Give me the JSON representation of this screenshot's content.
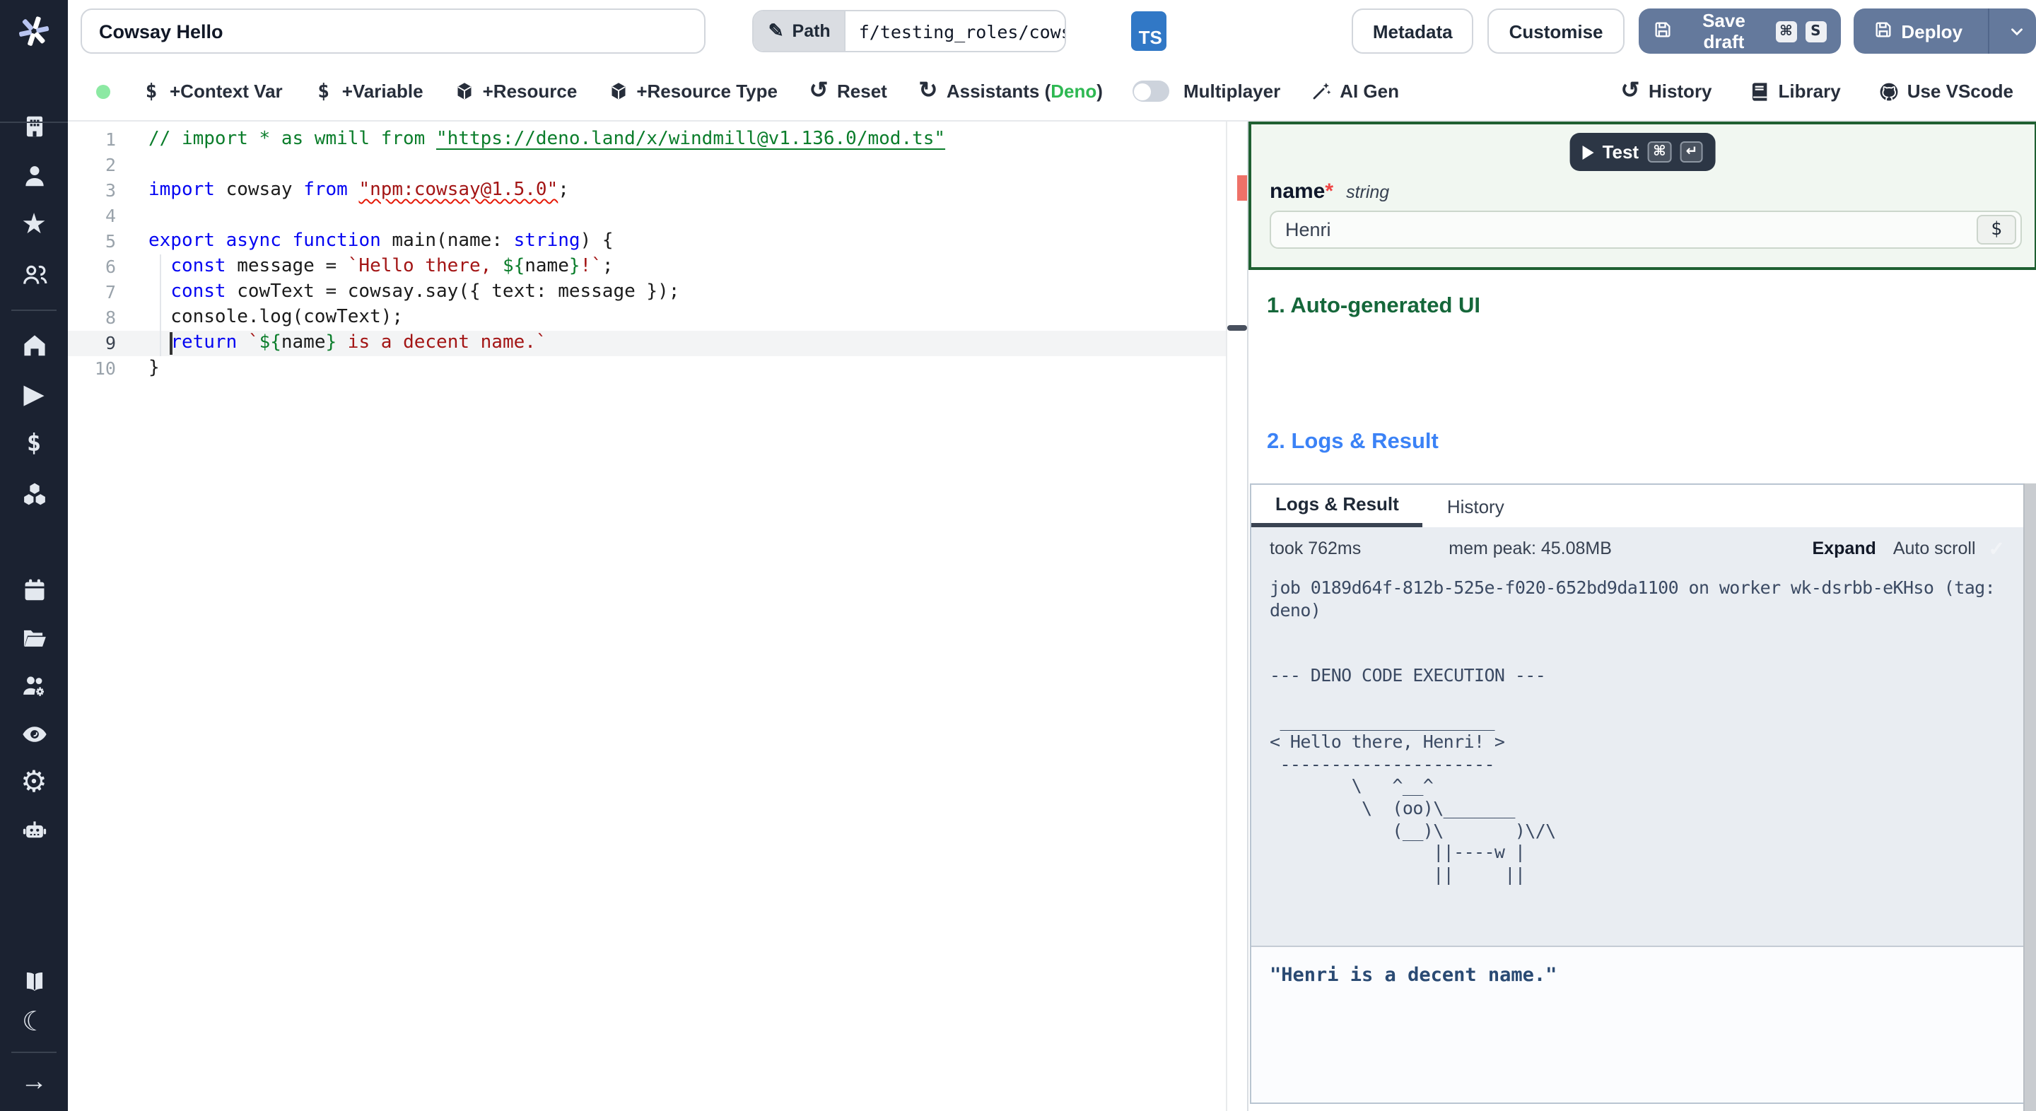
{
  "topbar": {
    "title_value": "Cowsay Hello",
    "path_label": "Path",
    "path_value": "f/testing_roles/cowsa",
    "lang_badge": "TS",
    "metadata_label": "Metadata",
    "customise_label": "Customise",
    "save_draft_label": "Save draft",
    "save_kbd": [
      "⌘",
      "S"
    ],
    "deploy_label": "Deploy"
  },
  "toolbar": {
    "items": [
      {
        "name": "context-var",
        "icon": "dollar",
        "label": "+Context Var"
      },
      {
        "name": "variable",
        "icon": "dollar",
        "label": "+Variable"
      },
      {
        "name": "resource",
        "icon": "package",
        "label": "+Resource"
      },
      {
        "name": "resource-type",
        "icon": "package",
        "label": "+Resource Type"
      },
      {
        "name": "reset",
        "icon": "undo",
        "label": "Reset"
      },
      {
        "name": "assistants",
        "icon": "refresh",
        "label": "Assistants (",
        "accent": "Deno",
        "suffix": ")"
      }
    ],
    "multiplayer_label": "Multiplayer",
    "ai_gen_label": "AI Gen",
    "right_items": [
      {
        "name": "history",
        "icon": "history",
        "label": "History"
      },
      {
        "name": "library",
        "icon": "book",
        "label": "Library"
      },
      {
        "name": "vscode",
        "icon": "github",
        "label": "Use VScode"
      }
    ]
  },
  "colors": {
    "accent_green": "#2eb852",
    "status_dot": "#8ce9a3",
    "slate_button": "#64799c",
    "ts_blue": "#3178c6",
    "section_green": "#15673a",
    "section_blue": "#3b82f6",
    "error_marker": "#ee7168"
  },
  "sidebar": {
    "groups": [
      [
        "building",
        "user",
        "star",
        "users"
      ],
      [
        "home",
        "play",
        "dollar-sign",
        "boxes"
      ],
      [
        "calendar",
        "folder",
        "users-gear",
        "eye",
        "settings",
        "robot"
      ],
      [
        "book-open",
        "moon"
      ],
      [
        "arrow-right"
      ]
    ]
  },
  "editor": {
    "active_line": 9,
    "lines": [
      {
        "n": 1,
        "segs": [
          [
            "c",
            "// import * as wmill from "
          ],
          [
            "cl",
            "\"https://deno.land/x/windmill@v1.136.0/mod.ts\""
          ]
        ]
      },
      {
        "n": 2,
        "segs": []
      },
      {
        "n": 3,
        "segs": [
          [
            "k",
            "import"
          ],
          [
            "p",
            " cowsay "
          ],
          [
            "k",
            "from"
          ],
          [
            "p",
            " "
          ],
          [
            "se",
            "\"npm:cowsay@1.5.0\""
          ],
          [
            "p",
            ";"
          ]
        ]
      },
      {
        "n": 4,
        "segs": []
      },
      {
        "n": 5,
        "segs": [
          [
            "k",
            "export"
          ],
          [
            "p",
            " "
          ],
          [
            "k",
            "async"
          ],
          [
            "p",
            " "
          ],
          [
            "k",
            "function"
          ],
          [
            "p",
            " main(name: "
          ],
          [
            "k",
            "string"
          ],
          [
            "p",
            ") {"
          ]
        ]
      },
      {
        "n": 6,
        "segs": [
          [
            "p",
            "  "
          ],
          [
            "k",
            "const"
          ],
          [
            "p",
            " message = "
          ],
          [
            "s",
            "`Hello there, "
          ],
          [
            "t",
            "${"
          ],
          [
            "p",
            "name"
          ],
          [
            "t",
            "}"
          ],
          [
            "s",
            "!`"
          ],
          [
            "p",
            ";"
          ]
        ]
      },
      {
        "n": 7,
        "segs": [
          [
            "p",
            "  "
          ],
          [
            "k",
            "const"
          ],
          [
            "p",
            " cowText = cowsay.say({ text: message });"
          ]
        ]
      },
      {
        "n": 8,
        "segs": [
          [
            "p",
            "  console.log(cowText);"
          ]
        ]
      },
      {
        "n": 9,
        "segs": [
          [
            "p",
            "  "
          ],
          [
            "k",
            "return"
          ],
          [
            "p",
            " "
          ],
          [
            "s",
            "`"
          ],
          [
            "t",
            "${"
          ],
          [
            "p",
            "name"
          ],
          [
            "t",
            "}"
          ],
          [
            "s",
            " is a decent name.`"
          ]
        ]
      },
      {
        "n": 10,
        "segs": [
          [
            "p",
            "}"
          ]
        ]
      }
    ]
  },
  "panel": {
    "test_label": "Test",
    "test_kbd": [
      "⌘",
      "↵"
    ],
    "field_name": "name",
    "field_required": "*",
    "field_type": "string",
    "field_value": "Henri",
    "field_suffix": "$",
    "section_1": "1. Auto-generated UI",
    "section_2": "2. Logs & Result",
    "tabs": [
      "Logs & Result",
      "History"
    ],
    "stats": {
      "took": "took 762ms",
      "mem": "mem peak: 45.08MB",
      "expand": "Expand",
      "autoscroll": "Auto scroll",
      "check": "✓"
    },
    "log_text": "job 0189d64f-812b-525e-f020-652bd9da1100 on worker wk-dsrbb-eKHso (tag:\ndeno)\n\n\n--- DENO CODE EXECUTION ---\n\n _____________________\n< Hello there, Henri! >\n ---------------------\n        \\   ^__^\n         \\  (oo)\\_______\n            (__)\\       )\\/\\\n                ||----w |\n                ||     ||",
    "result_text": "\"Henri is a decent name.\""
  }
}
